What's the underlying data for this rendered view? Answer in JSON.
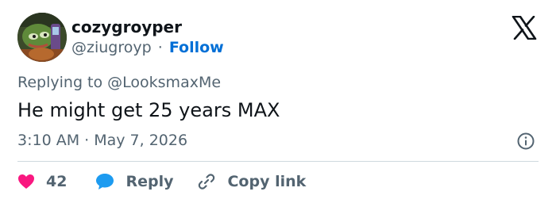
{
  "user": {
    "display_name": "cozygroyper",
    "handle": "@ziugroyp",
    "follow_label": "Follow"
  },
  "tweet": {
    "reply_prefix": "Replying to ",
    "reply_to": "@LooksmaxMe",
    "text": "He might get 25 years MAX",
    "timestamp": "3:10 AM · May 7, 2026"
  },
  "actions": {
    "like_count": "42",
    "reply_label": "Reply",
    "copy_link_label": "Copy link"
  },
  "colors": {
    "like": "#f91880",
    "reply": "#1d9bf0",
    "follow": "#006fd6",
    "secondary_text": "#536471"
  },
  "icons": [
    "x-logo-icon",
    "info-icon",
    "heart-icon",
    "reply-bubble-icon",
    "link-icon"
  ]
}
